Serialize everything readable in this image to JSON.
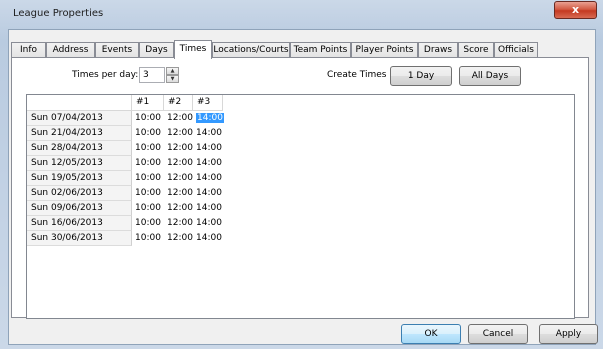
{
  "window": {
    "title": "League Properties",
    "close_label": "x"
  },
  "tabs": [
    {
      "label": "Info"
    },
    {
      "label": "Address"
    },
    {
      "label": "Events"
    },
    {
      "label": "Days"
    },
    {
      "label": "Times",
      "active": true
    },
    {
      "label": "Locations/Courts"
    },
    {
      "label": "Team Points"
    },
    {
      "label": "Player Points"
    },
    {
      "label": "Draws"
    },
    {
      "label": "Score"
    },
    {
      "label": "Officials"
    }
  ],
  "times": {
    "per_day_label": "Times per day:",
    "per_day_value": "3",
    "create_label": "Create Times",
    "one_day_button": "1 Day",
    "all_days_button": "All Days"
  },
  "grid": {
    "columns": [
      "#1",
      "#2",
      "#3"
    ],
    "rows": [
      {
        "date": "Sun 07/04/2013",
        "t1": "10:00",
        "t2": "12:00",
        "t3": "14:00"
      },
      {
        "date": "Sun 21/04/2013",
        "t1": "10:00",
        "t2": "12:00",
        "t3": "14:00"
      },
      {
        "date": "Sun 28/04/2013",
        "t1": "10:00",
        "t2": "12:00",
        "t3": "14:00"
      },
      {
        "date": "Sun 12/05/2013",
        "t1": "10:00",
        "t2": "12:00",
        "t3": "14:00"
      },
      {
        "date": "Sun 19/05/2013",
        "t1": "10:00",
        "t2": "12:00",
        "t3": "14:00"
      },
      {
        "date": "Sun 02/06/2013",
        "t1": "10:00",
        "t2": "12:00",
        "t3": "14:00"
      },
      {
        "date": "Sun 09/06/2013",
        "t1": "10:00",
        "t2": "12:00",
        "t3": "14:00"
      },
      {
        "date": "Sun 16/06/2013",
        "t1": "10:00",
        "t2": "12:00",
        "t3": "14:00"
      },
      {
        "date": "Sun 30/06/2013",
        "t1": "10:00",
        "t2": "12:00",
        "t3": "14:00"
      }
    ],
    "selected_cell": "14:00"
  },
  "footer": {
    "ok_label": "OK",
    "cancel_label": "Cancel",
    "apply_label": "Apply"
  },
  "colors": {
    "selection": "#3399ff",
    "close_button": "#c43a22",
    "default_button_border": "#3c7fb1"
  }
}
